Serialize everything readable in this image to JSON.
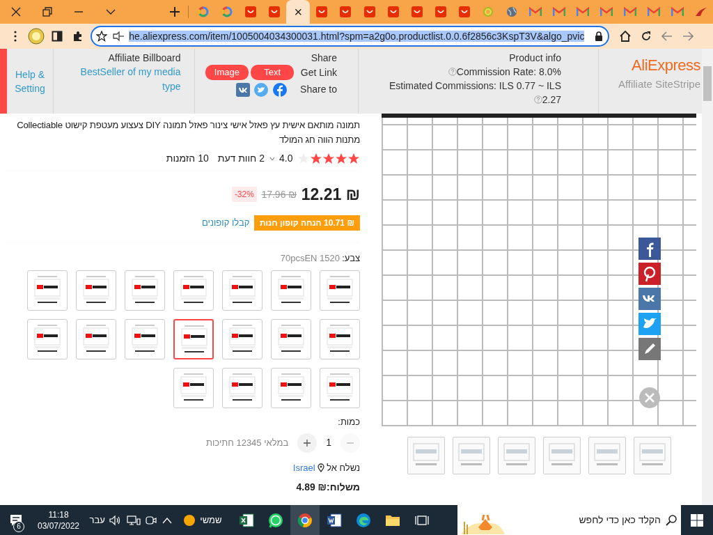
{
  "browser": {
    "tabs": [
      {
        "kind": "google",
        "selected": false
      },
      {
        "kind": "google",
        "selected": false
      },
      {
        "kind": "aliexpress",
        "selected": false
      },
      {
        "kind": "aliexpress",
        "selected": false
      },
      {
        "selected": true
      },
      {
        "kind": "aliexpress",
        "selected": false
      },
      {
        "kind": "aliexpress",
        "selected": false
      },
      {
        "kind": "aliexpress",
        "selected": false
      },
      {
        "kind": "aliexpress",
        "selected": false
      },
      {
        "kind": "aliexpress",
        "selected": false
      },
      {
        "kind": "aliexpress",
        "selected": false
      },
      {
        "kind": "aliexpress",
        "selected": false
      },
      {
        "kind": "ring",
        "selected": false
      },
      {
        "kind": "globe",
        "selected": false
      },
      {
        "kind": "gmail",
        "selected": false
      },
      {
        "kind": "gmail",
        "selected": false
      },
      {
        "kind": "gmail",
        "selected": false
      },
      {
        "kind": "gmail",
        "selected": false
      },
      {
        "kind": "gmail",
        "selected": false
      },
      {
        "kind": "gmail",
        "selected": false
      },
      {
        "kind": "gmail",
        "selected": false
      },
      {
        "kind": "swoosh",
        "selected": false
      }
    ],
    "tab_close": "×",
    "url": "he.aliexpress.com/item/1005004034300031.html?spm=a2g0o.productlist.0.0.6f2856c3KspT3V&algo_pvic"
  },
  "affiliate": {
    "help": "Help & Setting",
    "billboard": {
      "title": "Affiliate Billboard",
      "link": "BestSeller of my media type"
    },
    "share": {
      "title": "Share",
      "image_button": "Image",
      "text_button": "Text",
      "get_link": "Get Link",
      "share_to": "Share to"
    },
    "product_info": {
      "title": "Product info",
      "commission_rate": "Commission Rate: 8.0%",
      "estimated": "Estimated Commissions: ILS 0.77 ~ ILS",
      "estimated_max": "2.27"
    },
    "logo": "AliExpress",
    "subtitle": "Affiliate SiteStripe"
  },
  "product": {
    "title": "תמונה מותאם אישית עץ פאזל אישי צינור פאזל תמונה DIY צעצוע מעטפת קישוט Collectiable מתנות הווה חג המולד",
    "rating": {
      "stars": 4,
      "score": "4.0",
      "reviews": "2 חוות דעת",
      "orders": "10 הזמנות"
    },
    "price": "₪ 12.21",
    "old_price": "₪ 17.96",
    "discount": "-32%",
    "coupon": "₪ 10.71 הנחה קופון חנות",
    "coupon_link": "קבלו קופונים",
    "color_label": "צבע:",
    "color_value": "70pcsEN 1520",
    "color_options": [
      {
        "selected": false
      },
      {
        "selected": false
      },
      {
        "selected": false
      },
      {
        "selected": false
      },
      {
        "selected": false
      },
      {
        "selected": false
      },
      {
        "selected": false
      },
      {
        "selected": false
      },
      {
        "selected": false
      },
      {
        "selected": false
      },
      {
        "selected": true
      },
      {
        "selected": false
      },
      {
        "selected": false
      },
      {
        "selected": false
      },
      {
        "selected": false
      },
      {
        "selected": false
      },
      {
        "selected": false
      },
      {
        "selected": false
      }
    ],
    "quantity_label": "כמות:",
    "quantity": "1",
    "decrement_disabled": true,
    "stock": "במלאי 12345 חתיכות",
    "ship_to_label": "נשלח אל",
    "ship_to": "Israel",
    "shipping": "משלוח:₪ 4.89",
    "gallery": [
      {
        "selected": false
      },
      {
        "selected": false
      },
      {
        "selected": false
      },
      {
        "selected": false
      },
      {
        "selected": false
      },
      {
        "selected": false
      }
    ]
  },
  "taskbar": {
    "notifications": "6",
    "time": "11:18",
    "date": "03/07/2022",
    "language": "עבר",
    "weather": "שמשי",
    "search_placeholder": "הקלד כאן כדי לחפש",
    "apps": [
      {
        "kind": "excel",
        "selected": false
      },
      {
        "kind": "whatsapp",
        "selected": false
      },
      {
        "kind": "chrome",
        "selected": true
      },
      {
        "kind": "word",
        "selected": false
      },
      {
        "kind": "edge",
        "selected": false
      },
      {
        "kind": "explorer",
        "selected": false
      },
      {
        "kind": "taskview",
        "selected": false
      }
    ]
  }
}
